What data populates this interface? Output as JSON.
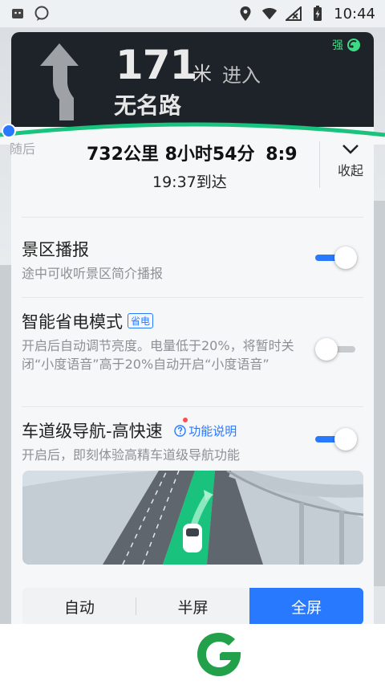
{
  "status_bar": {
    "time": "10:44",
    "icons": [
      "android-icon",
      "message-icon",
      "location-icon",
      "wifi-icon",
      "no-signal-icon",
      "battery-charging-icon"
    ]
  },
  "guidance": {
    "distance": "171",
    "unit": "米",
    "action": "进入",
    "road": "无名路",
    "signal_label": "强"
  },
  "summary": {
    "exit_hint": "随后",
    "trip": "732公里 8小时54分",
    "extra": "8:9",
    "eta": "19:37到达",
    "collapse_label": "收起"
  },
  "settings": [
    {
      "title": "景区播报",
      "desc": "途中可收听景区简介播报",
      "on": true
    },
    {
      "title": "智能省电模式",
      "badge": "省电",
      "desc": "开启后自动调节亮度。电量低于20%，将暂时关闭“小度语音”高于20%自动开启“小度语音”",
      "on": false
    },
    {
      "title": "车道级导航-高快速",
      "help": "功能说明",
      "desc": "开启后，即刻体验高精车道级导航功能",
      "on": true
    }
  ],
  "modes": {
    "auto": "自动",
    "half": "半屏",
    "full": "全屏",
    "selected": "全屏"
  },
  "colors": {
    "accent": "#2979ff",
    "nav_bg": "#1d2329",
    "arc_green": "#19c37d"
  }
}
